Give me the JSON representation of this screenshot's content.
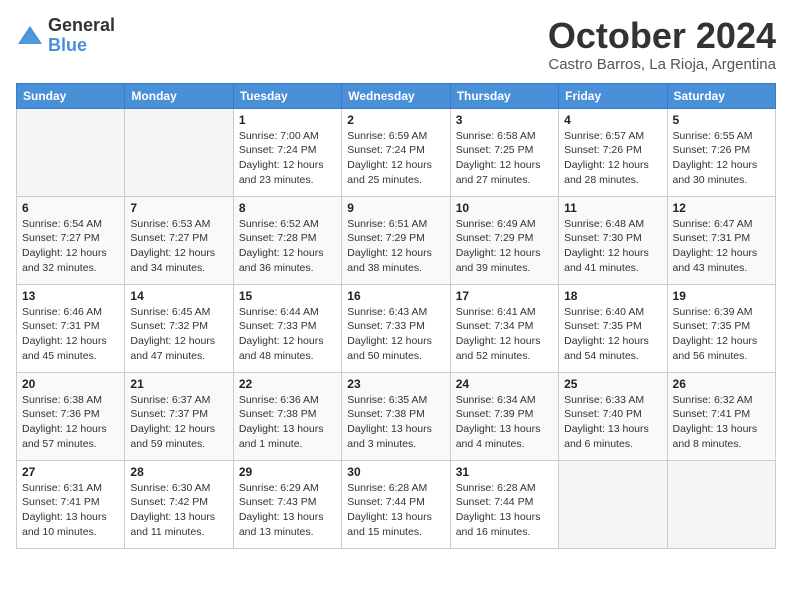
{
  "logo": {
    "general": "General",
    "blue": "Blue"
  },
  "header": {
    "month": "October 2024",
    "location": "Castro Barros, La Rioja, Argentina"
  },
  "days_of_week": [
    "Sunday",
    "Monday",
    "Tuesday",
    "Wednesday",
    "Thursday",
    "Friday",
    "Saturday"
  ],
  "weeks": [
    [
      {
        "day": "",
        "detail": ""
      },
      {
        "day": "",
        "detail": ""
      },
      {
        "day": "1",
        "detail": "Sunrise: 7:00 AM\nSunset: 7:24 PM\nDaylight: 12 hours\nand 23 minutes."
      },
      {
        "day": "2",
        "detail": "Sunrise: 6:59 AM\nSunset: 7:24 PM\nDaylight: 12 hours\nand 25 minutes."
      },
      {
        "day": "3",
        "detail": "Sunrise: 6:58 AM\nSunset: 7:25 PM\nDaylight: 12 hours\nand 27 minutes."
      },
      {
        "day": "4",
        "detail": "Sunrise: 6:57 AM\nSunset: 7:26 PM\nDaylight: 12 hours\nand 28 minutes."
      },
      {
        "day": "5",
        "detail": "Sunrise: 6:55 AM\nSunset: 7:26 PM\nDaylight: 12 hours\nand 30 minutes."
      }
    ],
    [
      {
        "day": "6",
        "detail": "Sunrise: 6:54 AM\nSunset: 7:27 PM\nDaylight: 12 hours\nand 32 minutes."
      },
      {
        "day": "7",
        "detail": "Sunrise: 6:53 AM\nSunset: 7:27 PM\nDaylight: 12 hours\nand 34 minutes."
      },
      {
        "day": "8",
        "detail": "Sunrise: 6:52 AM\nSunset: 7:28 PM\nDaylight: 12 hours\nand 36 minutes."
      },
      {
        "day": "9",
        "detail": "Sunrise: 6:51 AM\nSunset: 7:29 PM\nDaylight: 12 hours\nand 38 minutes."
      },
      {
        "day": "10",
        "detail": "Sunrise: 6:49 AM\nSunset: 7:29 PM\nDaylight: 12 hours\nand 39 minutes."
      },
      {
        "day": "11",
        "detail": "Sunrise: 6:48 AM\nSunset: 7:30 PM\nDaylight: 12 hours\nand 41 minutes."
      },
      {
        "day": "12",
        "detail": "Sunrise: 6:47 AM\nSunset: 7:31 PM\nDaylight: 12 hours\nand 43 minutes."
      }
    ],
    [
      {
        "day": "13",
        "detail": "Sunrise: 6:46 AM\nSunset: 7:31 PM\nDaylight: 12 hours\nand 45 minutes."
      },
      {
        "day": "14",
        "detail": "Sunrise: 6:45 AM\nSunset: 7:32 PM\nDaylight: 12 hours\nand 47 minutes."
      },
      {
        "day": "15",
        "detail": "Sunrise: 6:44 AM\nSunset: 7:33 PM\nDaylight: 12 hours\nand 48 minutes."
      },
      {
        "day": "16",
        "detail": "Sunrise: 6:43 AM\nSunset: 7:33 PM\nDaylight: 12 hours\nand 50 minutes."
      },
      {
        "day": "17",
        "detail": "Sunrise: 6:41 AM\nSunset: 7:34 PM\nDaylight: 12 hours\nand 52 minutes."
      },
      {
        "day": "18",
        "detail": "Sunrise: 6:40 AM\nSunset: 7:35 PM\nDaylight: 12 hours\nand 54 minutes."
      },
      {
        "day": "19",
        "detail": "Sunrise: 6:39 AM\nSunset: 7:35 PM\nDaylight: 12 hours\nand 56 minutes."
      }
    ],
    [
      {
        "day": "20",
        "detail": "Sunrise: 6:38 AM\nSunset: 7:36 PM\nDaylight: 12 hours\nand 57 minutes."
      },
      {
        "day": "21",
        "detail": "Sunrise: 6:37 AM\nSunset: 7:37 PM\nDaylight: 12 hours\nand 59 minutes."
      },
      {
        "day": "22",
        "detail": "Sunrise: 6:36 AM\nSunset: 7:38 PM\nDaylight: 13 hours\nand 1 minute."
      },
      {
        "day": "23",
        "detail": "Sunrise: 6:35 AM\nSunset: 7:38 PM\nDaylight: 13 hours\nand 3 minutes."
      },
      {
        "day": "24",
        "detail": "Sunrise: 6:34 AM\nSunset: 7:39 PM\nDaylight: 13 hours\nand 4 minutes."
      },
      {
        "day": "25",
        "detail": "Sunrise: 6:33 AM\nSunset: 7:40 PM\nDaylight: 13 hours\nand 6 minutes."
      },
      {
        "day": "26",
        "detail": "Sunrise: 6:32 AM\nSunset: 7:41 PM\nDaylight: 13 hours\nand 8 minutes."
      }
    ],
    [
      {
        "day": "27",
        "detail": "Sunrise: 6:31 AM\nSunset: 7:41 PM\nDaylight: 13 hours\nand 10 minutes."
      },
      {
        "day": "28",
        "detail": "Sunrise: 6:30 AM\nSunset: 7:42 PM\nDaylight: 13 hours\nand 11 minutes."
      },
      {
        "day": "29",
        "detail": "Sunrise: 6:29 AM\nSunset: 7:43 PM\nDaylight: 13 hours\nand 13 minutes."
      },
      {
        "day": "30",
        "detail": "Sunrise: 6:28 AM\nSunset: 7:44 PM\nDaylight: 13 hours\nand 15 minutes."
      },
      {
        "day": "31",
        "detail": "Sunrise: 6:28 AM\nSunset: 7:44 PM\nDaylight: 13 hours\nand 16 minutes."
      },
      {
        "day": "",
        "detail": ""
      },
      {
        "day": "",
        "detail": ""
      }
    ]
  ]
}
